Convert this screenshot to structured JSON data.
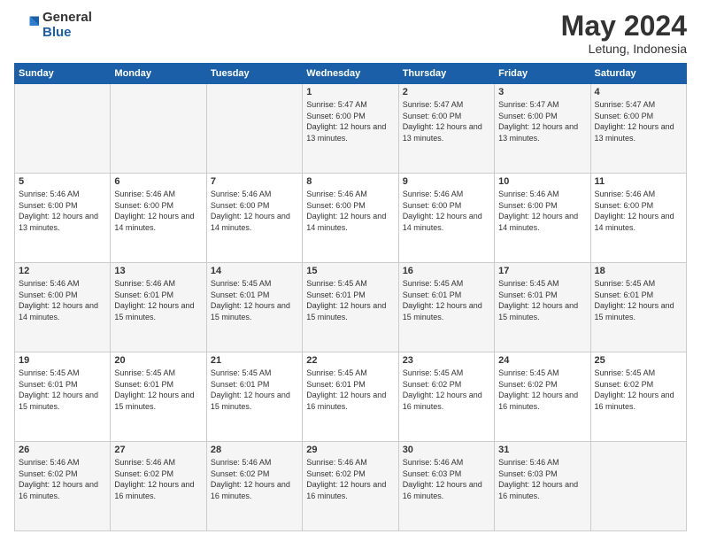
{
  "logo": {
    "general": "General",
    "blue": "Blue"
  },
  "header": {
    "month": "May 2024",
    "location": "Letung, Indonesia"
  },
  "weekdays": [
    "Sunday",
    "Monday",
    "Tuesday",
    "Wednesday",
    "Thursday",
    "Friday",
    "Saturday"
  ],
  "weeks": [
    [
      {
        "day": "",
        "sunrise": "",
        "sunset": "",
        "daylight": ""
      },
      {
        "day": "",
        "sunrise": "",
        "sunset": "",
        "daylight": ""
      },
      {
        "day": "",
        "sunrise": "",
        "sunset": "",
        "daylight": ""
      },
      {
        "day": "1",
        "sunrise": "Sunrise: 5:47 AM",
        "sunset": "Sunset: 6:00 PM",
        "daylight": "Daylight: 12 hours and 13 minutes."
      },
      {
        "day": "2",
        "sunrise": "Sunrise: 5:47 AM",
        "sunset": "Sunset: 6:00 PM",
        "daylight": "Daylight: 12 hours and 13 minutes."
      },
      {
        "day": "3",
        "sunrise": "Sunrise: 5:47 AM",
        "sunset": "Sunset: 6:00 PM",
        "daylight": "Daylight: 12 hours and 13 minutes."
      },
      {
        "day": "4",
        "sunrise": "Sunrise: 5:47 AM",
        "sunset": "Sunset: 6:00 PM",
        "daylight": "Daylight: 12 hours and 13 minutes."
      }
    ],
    [
      {
        "day": "5",
        "sunrise": "Sunrise: 5:46 AM",
        "sunset": "Sunset: 6:00 PM",
        "daylight": "Daylight: 12 hours and 13 minutes."
      },
      {
        "day": "6",
        "sunrise": "Sunrise: 5:46 AM",
        "sunset": "Sunset: 6:00 PM",
        "daylight": "Daylight: 12 hours and 14 minutes."
      },
      {
        "day": "7",
        "sunrise": "Sunrise: 5:46 AM",
        "sunset": "Sunset: 6:00 PM",
        "daylight": "Daylight: 12 hours and 14 minutes."
      },
      {
        "day": "8",
        "sunrise": "Sunrise: 5:46 AM",
        "sunset": "Sunset: 6:00 PM",
        "daylight": "Daylight: 12 hours and 14 minutes."
      },
      {
        "day": "9",
        "sunrise": "Sunrise: 5:46 AM",
        "sunset": "Sunset: 6:00 PM",
        "daylight": "Daylight: 12 hours and 14 minutes."
      },
      {
        "day": "10",
        "sunrise": "Sunrise: 5:46 AM",
        "sunset": "Sunset: 6:00 PM",
        "daylight": "Daylight: 12 hours and 14 minutes."
      },
      {
        "day": "11",
        "sunrise": "Sunrise: 5:46 AM",
        "sunset": "Sunset: 6:00 PM",
        "daylight": "Daylight: 12 hours and 14 minutes."
      }
    ],
    [
      {
        "day": "12",
        "sunrise": "Sunrise: 5:46 AM",
        "sunset": "Sunset: 6:00 PM",
        "daylight": "Daylight: 12 hours and 14 minutes."
      },
      {
        "day": "13",
        "sunrise": "Sunrise: 5:46 AM",
        "sunset": "Sunset: 6:01 PM",
        "daylight": "Daylight: 12 hours and 15 minutes."
      },
      {
        "day": "14",
        "sunrise": "Sunrise: 5:45 AM",
        "sunset": "Sunset: 6:01 PM",
        "daylight": "Daylight: 12 hours and 15 minutes."
      },
      {
        "day": "15",
        "sunrise": "Sunrise: 5:45 AM",
        "sunset": "Sunset: 6:01 PM",
        "daylight": "Daylight: 12 hours and 15 minutes."
      },
      {
        "day": "16",
        "sunrise": "Sunrise: 5:45 AM",
        "sunset": "Sunset: 6:01 PM",
        "daylight": "Daylight: 12 hours and 15 minutes."
      },
      {
        "day": "17",
        "sunrise": "Sunrise: 5:45 AM",
        "sunset": "Sunset: 6:01 PM",
        "daylight": "Daylight: 12 hours and 15 minutes."
      },
      {
        "day": "18",
        "sunrise": "Sunrise: 5:45 AM",
        "sunset": "Sunset: 6:01 PM",
        "daylight": "Daylight: 12 hours and 15 minutes."
      }
    ],
    [
      {
        "day": "19",
        "sunrise": "Sunrise: 5:45 AM",
        "sunset": "Sunset: 6:01 PM",
        "daylight": "Daylight: 12 hours and 15 minutes."
      },
      {
        "day": "20",
        "sunrise": "Sunrise: 5:45 AM",
        "sunset": "Sunset: 6:01 PM",
        "daylight": "Daylight: 12 hours and 15 minutes."
      },
      {
        "day": "21",
        "sunrise": "Sunrise: 5:45 AM",
        "sunset": "Sunset: 6:01 PM",
        "daylight": "Daylight: 12 hours and 15 minutes."
      },
      {
        "day": "22",
        "sunrise": "Sunrise: 5:45 AM",
        "sunset": "Sunset: 6:01 PM",
        "daylight": "Daylight: 12 hours and 16 minutes."
      },
      {
        "day": "23",
        "sunrise": "Sunrise: 5:45 AM",
        "sunset": "Sunset: 6:02 PM",
        "daylight": "Daylight: 12 hours and 16 minutes."
      },
      {
        "day": "24",
        "sunrise": "Sunrise: 5:45 AM",
        "sunset": "Sunset: 6:02 PM",
        "daylight": "Daylight: 12 hours and 16 minutes."
      },
      {
        "day": "25",
        "sunrise": "Sunrise: 5:45 AM",
        "sunset": "Sunset: 6:02 PM",
        "daylight": "Daylight: 12 hours and 16 minutes."
      }
    ],
    [
      {
        "day": "26",
        "sunrise": "Sunrise: 5:46 AM",
        "sunset": "Sunset: 6:02 PM",
        "daylight": "Daylight: 12 hours and 16 minutes."
      },
      {
        "day": "27",
        "sunrise": "Sunrise: 5:46 AM",
        "sunset": "Sunset: 6:02 PM",
        "daylight": "Daylight: 12 hours and 16 minutes."
      },
      {
        "day": "28",
        "sunrise": "Sunrise: 5:46 AM",
        "sunset": "Sunset: 6:02 PM",
        "daylight": "Daylight: 12 hours and 16 minutes."
      },
      {
        "day": "29",
        "sunrise": "Sunrise: 5:46 AM",
        "sunset": "Sunset: 6:02 PM",
        "daylight": "Daylight: 12 hours and 16 minutes."
      },
      {
        "day": "30",
        "sunrise": "Sunrise: 5:46 AM",
        "sunset": "Sunset: 6:03 PM",
        "daylight": "Daylight: 12 hours and 16 minutes."
      },
      {
        "day": "31",
        "sunrise": "Sunrise: 5:46 AM",
        "sunset": "Sunset: 6:03 PM",
        "daylight": "Daylight: 12 hours and 16 minutes."
      },
      {
        "day": "",
        "sunrise": "",
        "sunset": "",
        "daylight": ""
      }
    ]
  ]
}
